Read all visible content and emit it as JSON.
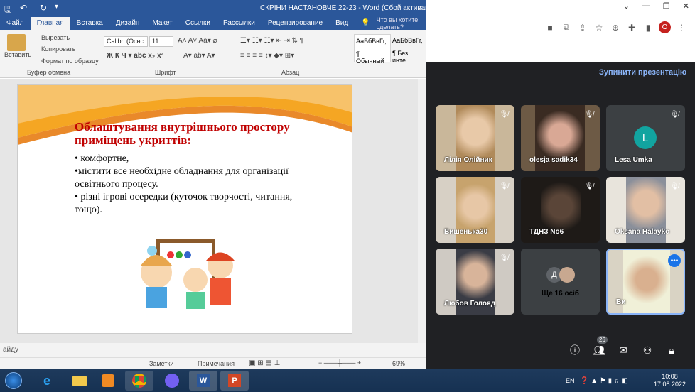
{
  "word": {
    "title": "СКРІНИ НАСТАНОВЧЕ 22-23 - Word (Сбой активации проду",
    "tabs": [
      "Файл",
      "Главная",
      "Вставка",
      "Дизайн",
      "Макет",
      "Ссылки",
      "Рассылки",
      "Рецензирование",
      "Вид"
    ],
    "tell_me": "Что вы хотите сделать?",
    "clipboard": {
      "paste": "Вставить",
      "cut": "Вырезать",
      "copy": "Копировать",
      "format": "Формат по образцу",
      "label": "Буфер обмена"
    },
    "font": {
      "name": "Calibri (Оснс",
      "size": "11",
      "label": "Шрифт"
    },
    "paragraph_label": "Абзац",
    "styles": [
      {
        "preview": "АаБбВвГг,",
        "name": "¶ Обычный"
      },
      {
        "preview": "АаБбВвГг,",
        "name": "¶ Без инте..."
      }
    ],
    "status_left": "айду",
    "notes": "Заметки",
    "comments": "Примечания",
    "zoom": "69%"
  },
  "slide": {
    "title": "Облаштування внутрішнього простору приміщень укриттів:",
    "bullets": [
      "• комфортне,",
      "•містити все необхідне обладнання для організації освітнього процесу.",
      "• різні ігрові осередки (куточок творчості, читання, тощо)."
    ]
  },
  "meet": {
    "stop_presenting": "Зупинити презентацію",
    "participants": [
      {
        "name": "Лілія Олійник",
        "muted": true
      },
      {
        "name": "olesja sadik34",
        "muted": true
      },
      {
        "name": "Lesa Umka",
        "muted": true,
        "initial": "L"
      },
      {
        "name": "Вишенька30",
        "muted": true
      },
      {
        "name": "ТДНЗ No6",
        "muted": true
      },
      {
        "name": "Oksana Halayko",
        "muted": true
      },
      {
        "name": "Любов Голояд",
        "muted": true
      },
      {
        "name": "Ще 16 осіб",
        "initial": "Д"
      },
      {
        "name": "Ви"
      }
    ],
    "participant_count": "26"
  },
  "taskbar": {
    "lang": "EN",
    "time": "10:08",
    "date": "17.08.2022"
  },
  "colors": {
    "word_blue": "#2b579a",
    "meet_bg": "#202124",
    "title_red": "#c00000",
    "accent_blue": "#8ab4f8"
  }
}
